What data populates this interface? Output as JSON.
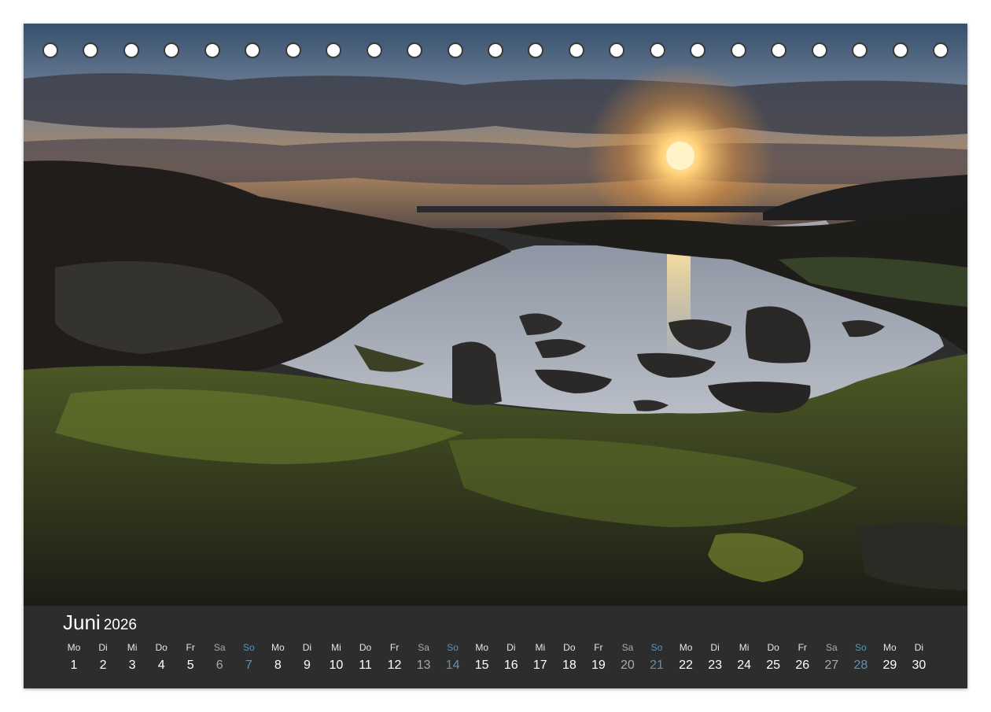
{
  "calendar": {
    "month": "Juni",
    "year": "2026",
    "days": [
      {
        "wd": "Mo",
        "d": "1",
        "kind": "weekday"
      },
      {
        "wd": "Di",
        "d": "2",
        "kind": "weekday"
      },
      {
        "wd": "Mi",
        "d": "3",
        "kind": "weekday"
      },
      {
        "wd": "Do",
        "d": "4",
        "kind": "weekday"
      },
      {
        "wd": "Fr",
        "d": "5",
        "kind": "weekday"
      },
      {
        "wd": "Sa",
        "d": "6",
        "kind": "saturday"
      },
      {
        "wd": "So",
        "d": "7",
        "kind": "sunday"
      },
      {
        "wd": "Mo",
        "d": "8",
        "kind": "weekday"
      },
      {
        "wd": "Di",
        "d": "9",
        "kind": "weekday"
      },
      {
        "wd": "Mi",
        "d": "10",
        "kind": "weekday"
      },
      {
        "wd": "Do",
        "d": "11",
        "kind": "weekday"
      },
      {
        "wd": "Fr",
        "d": "12",
        "kind": "weekday"
      },
      {
        "wd": "Sa",
        "d": "13",
        "kind": "saturday"
      },
      {
        "wd": "So",
        "d": "14",
        "kind": "sunday"
      },
      {
        "wd": "Mo",
        "d": "15",
        "kind": "weekday"
      },
      {
        "wd": "Di",
        "d": "16",
        "kind": "weekday"
      },
      {
        "wd": "Mi",
        "d": "17",
        "kind": "weekday"
      },
      {
        "wd": "Do",
        "d": "18",
        "kind": "weekday"
      },
      {
        "wd": "Fr",
        "d": "19",
        "kind": "weekday"
      },
      {
        "wd": "Sa",
        "d": "20",
        "kind": "saturday"
      },
      {
        "wd": "So",
        "d": "21",
        "kind": "sunday"
      },
      {
        "wd": "Mo",
        "d": "22",
        "kind": "weekday"
      },
      {
        "wd": "Di",
        "d": "23",
        "kind": "weekday"
      },
      {
        "wd": "Mi",
        "d": "24",
        "kind": "weekday"
      },
      {
        "wd": "Do",
        "d": "25",
        "kind": "weekday"
      },
      {
        "wd": "Fr",
        "d": "26",
        "kind": "weekday"
      },
      {
        "wd": "Sa",
        "d": "27",
        "kind": "saturday"
      },
      {
        "wd": "So",
        "d": "28",
        "kind": "sunday"
      },
      {
        "wd": "Mo",
        "d": "29",
        "kind": "weekday"
      },
      {
        "wd": "Di",
        "d": "30",
        "kind": "weekday"
      }
    ]
  },
  "binding": {
    "hole_count": 23
  },
  "colors": {
    "band": "#2d2d2d",
    "saturday": "#a9a9a9",
    "sunday": "#5c93b5",
    "sun_glow": "#ffd27a"
  },
  "photo": {
    "subject": "sunset-over-rocky-tidal-pool"
  }
}
